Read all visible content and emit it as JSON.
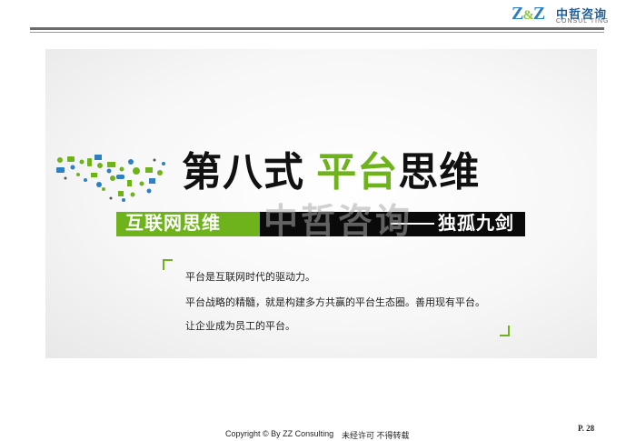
{
  "header": {
    "logo_mark": "Z&Z",
    "logo_cn": "中哲咨询",
    "logo_en": "CONSUL TING"
  },
  "slide": {
    "title_part1": "第八式 ",
    "title_part2": "平台",
    "title_part3": "思维",
    "band_left": "互联网思维",
    "band_right": "独孤九剑",
    "watermark": "中哲咨询",
    "body": [
      "平台是互联网时代的驱动力。",
      "平台战略的精髓，就是构建多方共赢的平台生态圈。善用现有平台。",
      "让企业成为员工的平台。"
    ]
  },
  "footer": {
    "copyright": "Copyright © By  ZZ Consulting",
    "note": "未经许可 不得转载",
    "page": "P. 28"
  },
  "colors": {
    "accent_green": "#6fb31c",
    "logo_blue": "#2f7fc1",
    "band_black": "#0a0a0a"
  }
}
